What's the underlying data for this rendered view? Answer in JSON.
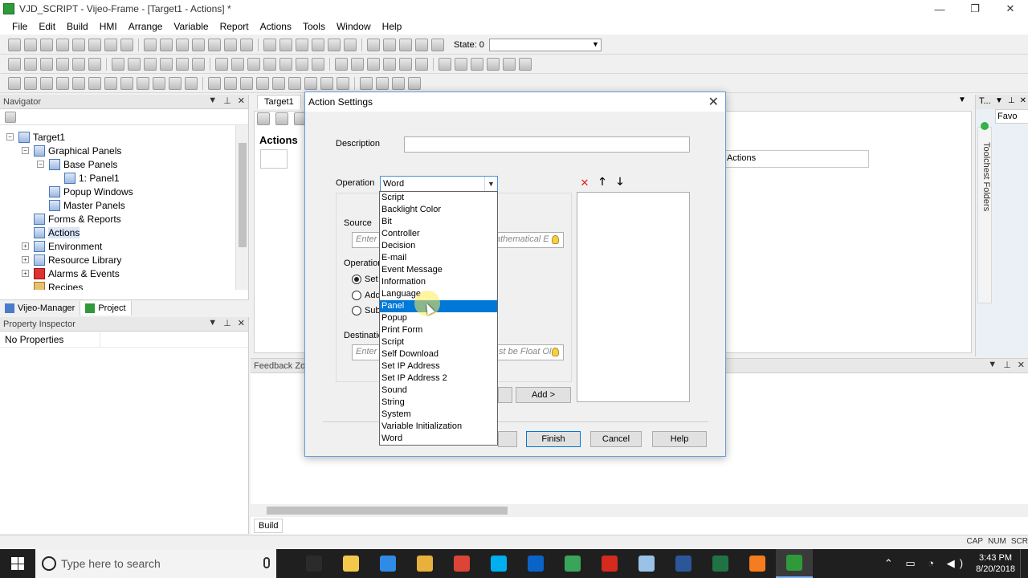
{
  "window": {
    "title": "VJD_SCRIPT - Vijeo-Frame - [Target1 - Actions] *",
    "minimize": "—",
    "maximize": "❐",
    "close": "✕"
  },
  "menu": [
    "File",
    "Edit",
    "Build",
    "HMI",
    "Arrange",
    "Variable",
    "Report",
    "Actions",
    "Tools",
    "Window",
    "Help"
  ],
  "toolbar": {
    "state_label": "State: 0"
  },
  "navigator": {
    "title": "Navigator",
    "items": [
      {
        "label": "Target1",
        "expander": "−"
      },
      {
        "label": "Graphical Panels",
        "expander": "−"
      },
      {
        "label": "Base Panels",
        "expander": "−"
      },
      {
        "label": "1: Panel1",
        "expander": ""
      },
      {
        "label": "Popup Windows",
        "expander": ""
      },
      {
        "label": "Master Panels",
        "expander": ""
      },
      {
        "label": "Forms & Reports",
        "expander": ""
      },
      {
        "label": "Actions",
        "expander": ""
      },
      {
        "label": "Environment",
        "expander": "+"
      },
      {
        "label": "Resource Library",
        "expander": "+"
      },
      {
        "label": "Alarms & Events",
        "expander": "+"
      },
      {
        "label": "Recipes",
        "expander": ""
      }
    ],
    "tabs": [
      "Vijeo-Manager",
      "Project"
    ]
  },
  "property_inspector": {
    "title": "Property Inspector",
    "empty_text": "No Properties"
  },
  "workspace": {
    "doc_tab": "Target1",
    "heading": "Actions",
    "column_header": "Actions",
    "dropdown_glyph": "▼"
  },
  "toolchest": {
    "title": "T...",
    "vertical_label": "Toolchest Folders",
    "fav_label": "Favo"
  },
  "feedback": {
    "title": "Feedback Zo",
    "build_tab": "Build"
  },
  "statusbar": [
    "CAP",
    "NUM",
    "SCR"
  ],
  "dialog": {
    "title": "Action Settings",
    "close_glyph": "✕",
    "description_label": "Description",
    "description_value": "",
    "operation_label": "Operation",
    "operation_value": "Word",
    "source_label": "Source",
    "source_placeholder": "Enter a",
    "source_suffix": "athematical E",
    "operation2_label": "Operation",
    "radios": [
      {
        "label": "Set",
        "checked": true
      },
      {
        "label": "Add",
        "checked": false
      },
      {
        "label": "Subt",
        "checked": false
      }
    ],
    "destination_label": "Destinatio",
    "destination_placeholder": "Enter a",
    "destination_suffix": "st be Float Ol",
    "add_button": "Add >",
    "finish_button": "Finish",
    "cancel_button": "Cancel",
    "help_button": "Help",
    "delete_glyph": "✕",
    "up_glyph": "🡑",
    "down_glyph": "🡓"
  },
  "dropdown_items": [
    "Script",
    "Backlight Color",
    "Bit",
    "Controller",
    "Decision",
    "E-mail",
    "Event Message",
    "Information",
    "Language",
    "Panel",
    "Popup",
    "Print Form",
    "Script",
    "Self Download",
    "Set IP Address",
    "Set IP Address 2",
    "Sound",
    "String",
    "System",
    "Variable Initialization",
    "Word"
  ],
  "dropdown_selected_index": 9,
  "taskbar": {
    "search_placeholder": "Type here to search",
    "time": "3:43 PM",
    "date": "8/20/2018",
    "apps": [
      {
        "name": "task-view",
        "color": "#2b2b2b"
      },
      {
        "name": "file-explorer",
        "color": "#f4c84a"
      },
      {
        "name": "edge",
        "color": "#2f8be6"
      },
      {
        "name": "folder",
        "color": "#e7b13b"
      },
      {
        "name": "chrome",
        "color": "#db4437"
      },
      {
        "name": "skype",
        "color": "#00aff0"
      },
      {
        "name": "outlook",
        "color": "#0a64c8"
      },
      {
        "name": "chart-app",
        "color": "#3aa55a"
      },
      {
        "name": "acrobat",
        "color": "#d52a1e"
      },
      {
        "name": "pen-app",
        "color": "#9ac2e6"
      },
      {
        "name": "word",
        "color": "#2b579a"
      },
      {
        "name": "excel",
        "color": "#217346"
      },
      {
        "name": "screen-recorder",
        "color": "#f57c1f"
      },
      {
        "name": "vijeo-frame",
        "color": "#2e9a3a"
      }
    ]
  }
}
